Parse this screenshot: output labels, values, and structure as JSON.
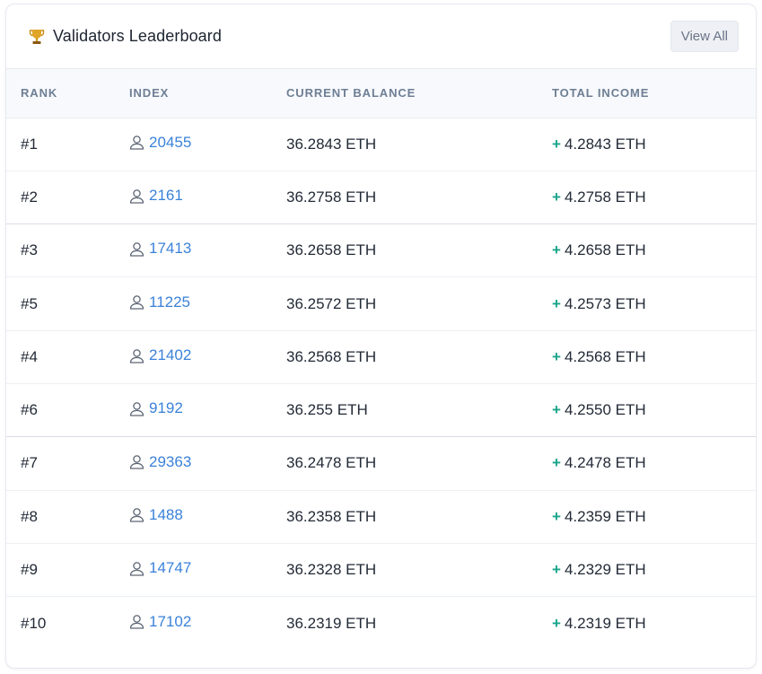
{
  "header": {
    "title": "Validators Leaderboard",
    "trophy_icon": "trophy-icon",
    "view_all_label": "View All"
  },
  "columns": {
    "rank": "RANK",
    "index": "INDEX",
    "balance": "CURRENT BALANCE",
    "income": "TOTAL INCOME"
  },
  "colors": {
    "link": "#3b82d9",
    "positive": "#1aa48a",
    "header_bg": "#f7f9fc"
  },
  "rows": [
    {
      "rank": "#1",
      "index": "20455",
      "balance": "36.2843 ETH",
      "income": "4.2843 ETH"
    },
    {
      "rank": "#2",
      "index": "2161",
      "balance": "36.2758 ETH",
      "income": "4.2758 ETH"
    },
    {
      "rank": "#3",
      "index": "17413",
      "balance": "36.2658 ETH",
      "income": "4.2658 ETH"
    },
    {
      "rank": "#5",
      "index": "11225",
      "balance": "36.2572 ETH",
      "income": "4.2573 ETH"
    },
    {
      "rank": "#4",
      "index": "21402",
      "balance": "36.2568 ETH",
      "income": "4.2568 ETH"
    },
    {
      "rank": "#6",
      "index": "9192",
      "balance": "36.255 ETH",
      "income": "4.2550 ETH"
    },
    {
      "rank": "#7",
      "index": "29363",
      "balance": "36.2478 ETH",
      "income": "4.2478 ETH"
    },
    {
      "rank": "#8",
      "index": "1488",
      "balance": "36.2358 ETH",
      "income": "4.2359 ETH"
    },
    {
      "rank": "#9",
      "index": "14747",
      "balance": "36.2328 ETH",
      "income": "4.2329 ETH"
    },
    {
      "rank": "#10",
      "index": "17102",
      "balance": "36.2319 ETH",
      "income": "4.2319 ETH"
    }
  ]
}
